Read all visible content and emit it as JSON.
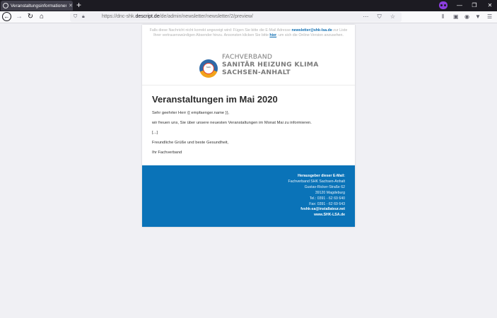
{
  "browser": {
    "tab_title": "Veranstaltungsinformationen",
    "tab_close": "✕",
    "new_tab": "+",
    "url_prefix": "https://dnc-shk.",
    "url_domain": "descript.de",
    "url_path": "/de/admin/newsletter/newsletter/2/preview/",
    "url_actions": "⋯ ⛉ ☆",
    "win_min": "—",
    "win_max": "❐",
    "win_close": "✕",
    "toolbar_icons": [
      "library-icon",
      "sidebar-icon",
      "account-icon",
      "extension-icon",
      "menu-icon"
    ]
  },
  "email": {
    "preheader_1": "Falls diese Nachricht nicht korrekt angezeigt wird: Fügen Sie bitte die E-Mail Adresse",
    "preheader_email": "newsletter@shk-lsa.de",
    "preheader_2": "zur Liste Ihrer vertrauenswürdigen Absender hinzu. Ansonsten klicken Sie bitte",
    "preheader_link": "hier",
    "preheader_3": ", um sich die Online-Version anzusehen.",
    "logo": {
      "line1": "FACHVERBAND",
      "line2": "SANITÄR HEIZUNG KLIMA",
      "line3": "SACHSEN-ANHALT",
      "icon_text": "SHK"
    },
    "headline": "Veranstaltungen im Mai 2020",
    "salutation": "Sehr geehrter Herr {{ empfaenger.name }},",
    "intro": "wir freuen uns, Sie über unsere neuesten Veranstaltungen im Monat Mai zu informieren.",
    "placeholder": "[...]",
    "closing": "Freundliche Grüße und beste Gesundheit,",
    "signature": "Ihr Fachverband",
    "footer": {
      "heading": "Herausgeber dieser E-Mail:",
      "org": "Fachverband SHK Sachsen-Anhalt",
      "street": "Gustav-Ricker-Straße 62",
      "city": "39120 Magdeburg",
      "tel": "Tel.: 0391 - 62 69 640",
      "fax": "Fax: 0391 - 62 69 643",
      "email": "fvshk-sa@installateur.net",
      "web": "www.SHK-LSA.de"
    }
  },
  "colors": {
    "footer_bg": "#0a73b8",
    "link": "#0b6bb0",
    "private_badge": "#8c3ee0"
  }
}
